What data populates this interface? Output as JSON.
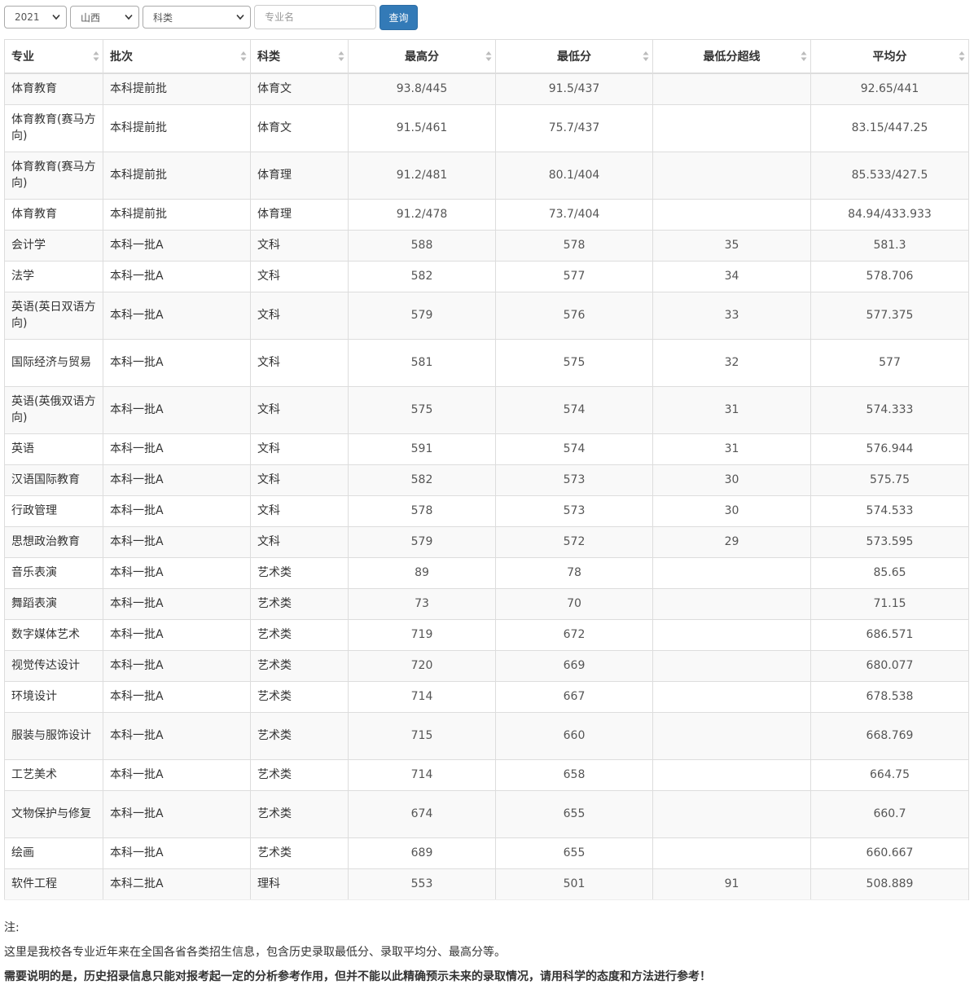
{
  "filters": {
    "year": "2021",
    "province": "山西",
    "category": "科类",
    "major_placeholder": "专业名",
    "query_label": "查询"
  },
  "table": {
    "headers": [
      "专业",
      "批次",
      "科类",
      "最高分",
      "最低分",
      "最低分超线",
      "平均分"
    ],
    "rows": [
      [
        "体育教育",
        "本科提前批",
        "体育文",
        "93.8/445",
        "91.5/437",
        "",
        "92.65/441"
      ],
      [
        "体育教育(赛马方向)",
        "本科提前批",
        "体育文",
        "91.5/461",
        "75.7/437",
        "",
        "83.15/447.25"
      ],
      [
        "体育教育(赛马方向)",
        "本科提前批",
        "体育理",
        "91.2/481",
        "80.1/404",
        "",
        "85.533/427.5"
      ],
      [
        "体育教育",
        "本科提前批",
        "体育理",
        "91.2/478",
        "73.7/404",
        "",
        "84.94/433.933"
      ],
      [
        "会计学",
        "本科一批A",
        "文科",
        "588",
        "578",
        "35",
        "581.3"
      ],
      [
        "法学",
        "本科一批A",
        "文科",
        "582",
        "577",
        "34",
        "578.706"
      ],
      [
        "英语(英日双语方向)",
        "本科一批A",
        "文科",
        "579",
        "576",
        "33",
        "577.375"
      ],
      [
        "国际经济与贸易",
        "本科一批A",
        "文科",
        "581",
        "575",
        "32",
        "577"
      ],
      [
        "英语(英俄双语方向)",
        "本科一批A",
        "文科",
        "575",
        "574",
        "31",
        "574.333"
      ],
      [
        "英语",
        "本科一批A",
        "文科",
        "591",
        "574",
        "31",
        "576.944"
      ],
      [
        "汉语国际教育",
        "本科一批A",
        "文科",
        "582",
        "573",
        "30",
        "575.75"
      ],
      [
        "行政管理",
        "本科一批A",
        "文科",
        "578",
        "573",
        "30",
        "574.533"
      ],
      [
        "思想政治教育",
        "本科一批A",
        "文科",
        "579",
        "572",
        "29",
        "573.595"
      ],
      [
        "音乐表演",
        "本科一批A",
        "艺术类",
        "89",
        "78",
        "",
        "85.65"
      ],
      [
        "舞蹈表演",
        "本科一批A",
        "艺术类",
        "73",
        "70",
        "",
        "71.15"
      ],
      [
        "数字媒体艺术",
        "本科一批A",
        "艺术类",
        "719",
        "672",
        "",
        "686.571"
      ],
      [
        "视觉传达设计",
        "本科一批A",
        "艺术类",
        "720",
        "669",
        "",
        "680.077"
      ],
      [
        "环境设计",
        "本科一批A",
        "艺术类",
        "714",
        "667",
        "",
        "678.538"
      ],
      [
        "服装与服饰设计",
        "本科一批A",
        "艺术类",
        "715",
        "660",
        "",
        "668.769"
      ],
      [
        "工艺美术",
        "本科一批A",
        "艺术类",
        "714",
        "658",
        "",
        "664.75"
      ],
      [
        "文物保护与修复",
        "本科一批A",
        "艺术类",
        "674",
        "655",
        "",
        "660.7"
      ],
      [
        "绘画",
        "本科一批A",
        "艺术类",
        "689",
        "655",
        "",
        "660.667"
      ],
      [
        "软件工程",
        "本科二批A",
        "理科",
        "553",
        "501",
        "91",
        "508.889"
      ]
    ]
  },
  "notes": {
    "title": "注:",
    "line1": "这里是我校各专业近年来在全国各省各类招生信息，包含历史录取最低分、录取平均分、最高分等。",
    "line2": "需要说明的是，历史招录信息只能对报考起一定的分析参考作用，但并不能以此精确预示未来的录取情况，请用科学的态度和方法进行参考！"
  },
  "colors": {
    "primary": "#337ab7",
    "border": "#dddddd",
    "stripe": "#f9f9f9"
  }
}
